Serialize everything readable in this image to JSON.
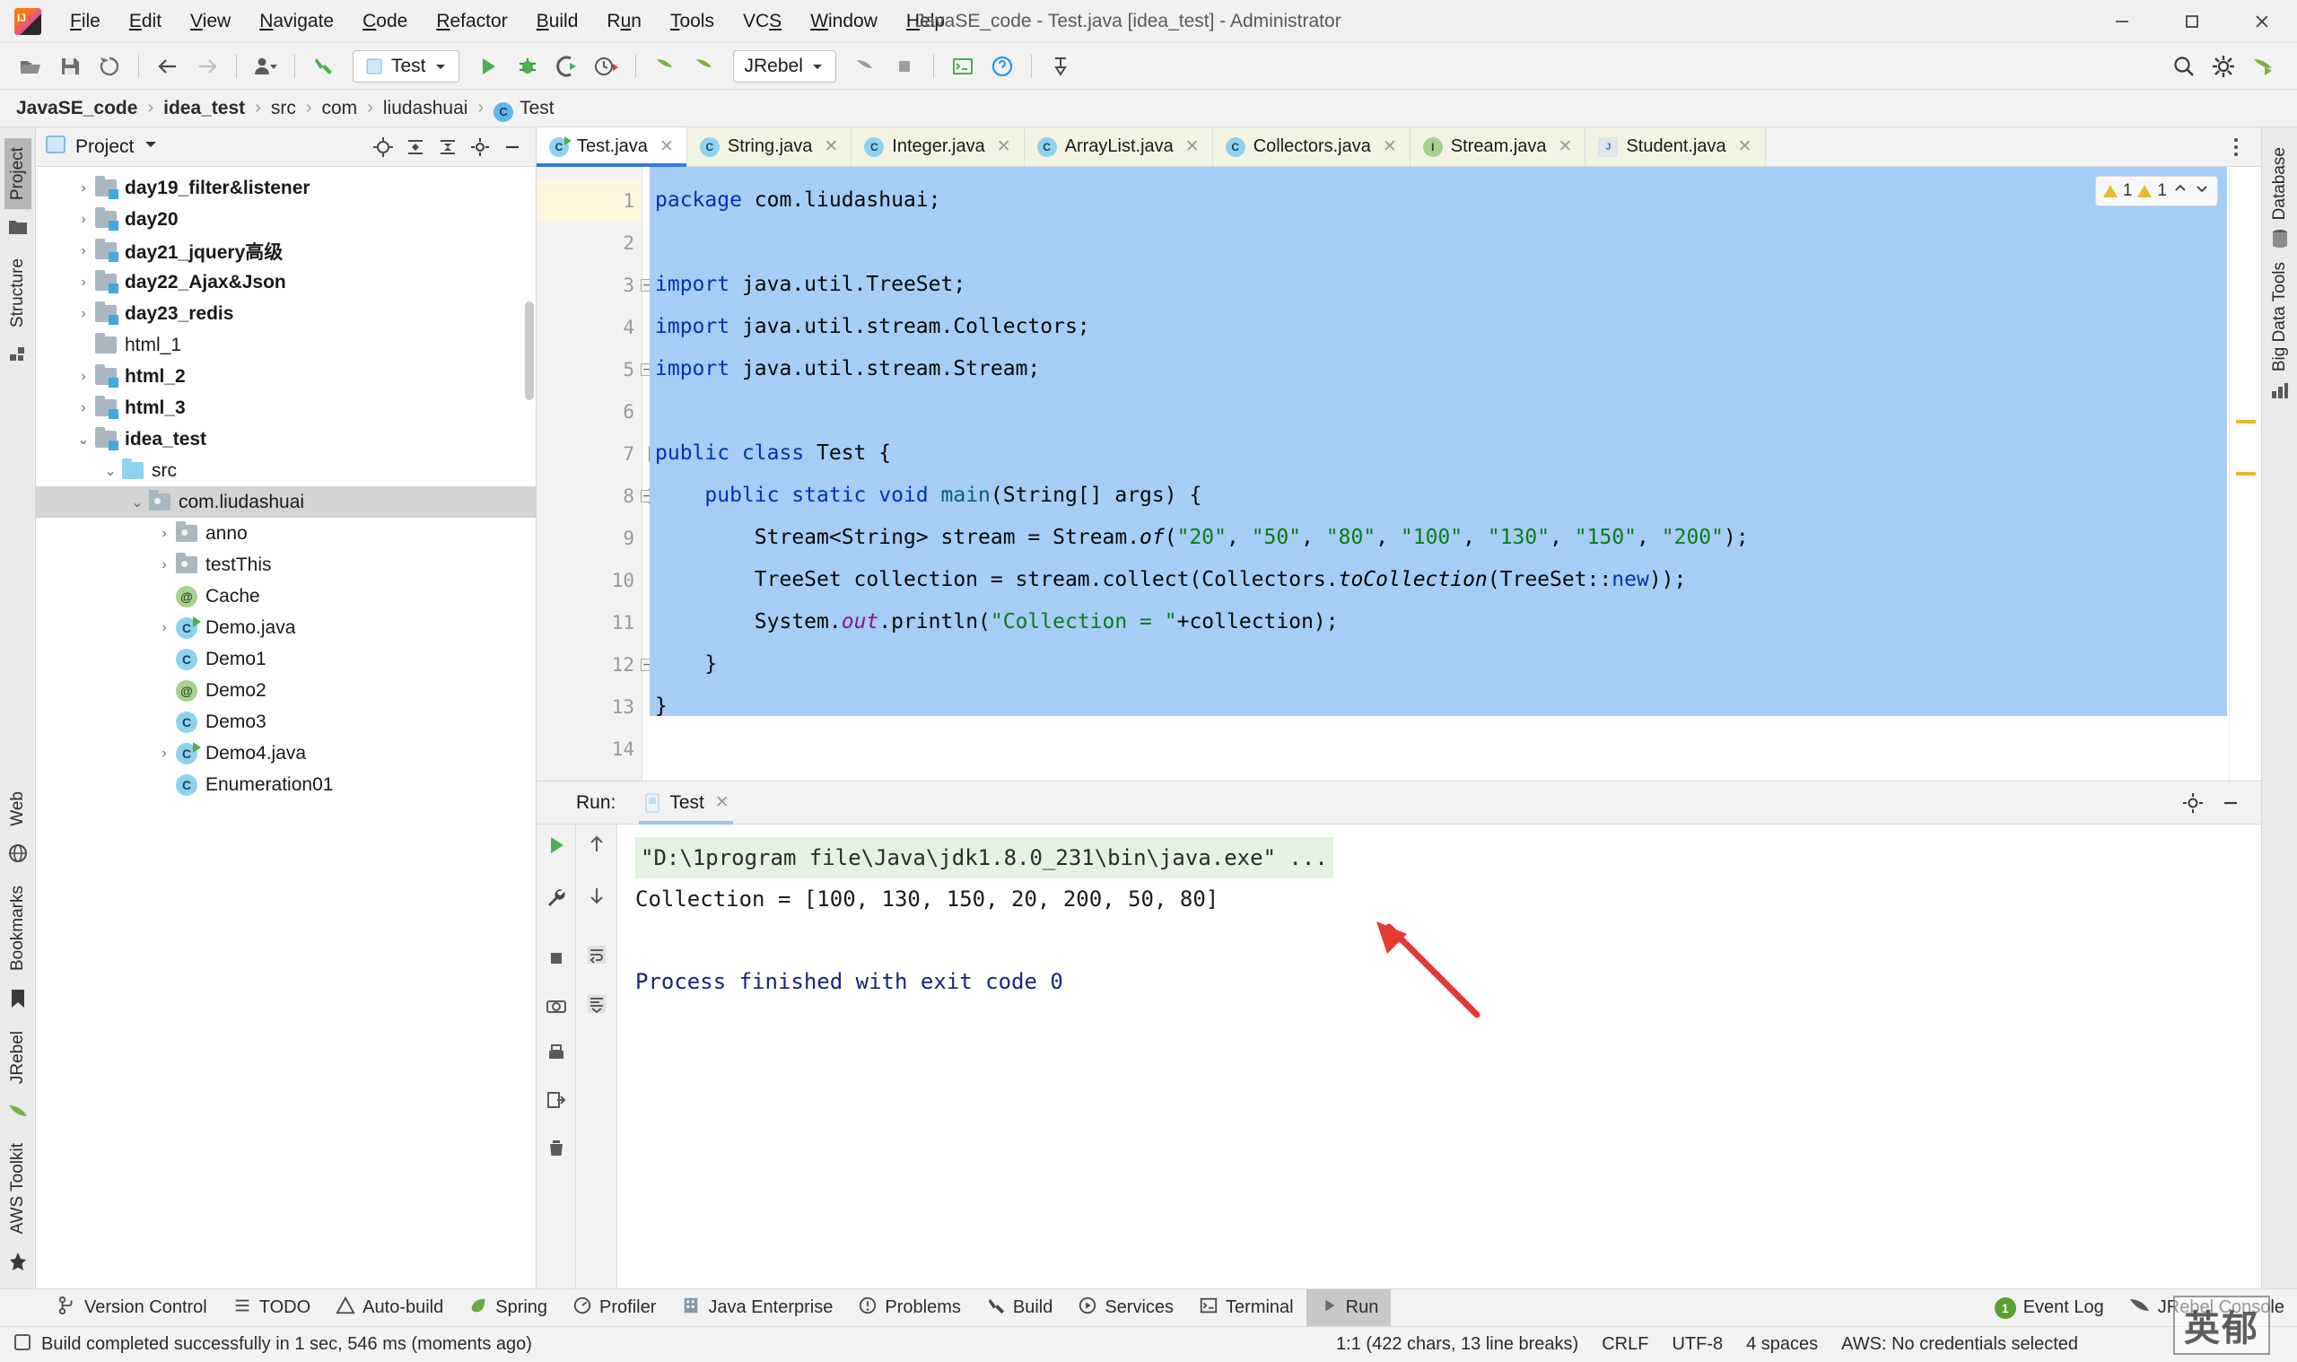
{
  "window": {
    "title": "JavaSE_code - Test.java [idea_test] - Administrator",
    "minimize": "—",
    "maximize": "❐",
    "close": "✕"
  },
  "menubar": [
    {
      "label": "File",
      "mnemonic": "F"
    },
    {
      "label": "Edit",
      "mnemonic": "E"
    },
    {
      "label": "View",
      "mnemonic": "V"
    },
    {
      "label": "Navigate",
      "mnemonic": "N"
    },
    {
      "label": "Code",
      "mnemonic": "C"
    },
    {
      "label": "Refactor",
      "mnemonic": "R"
    },
    {
      "label": "Build",
      "mnemonic": "B"
    },
    {
      "label": "Run",
      "mnemonic": "u"
    },
    {
      "label": "Tools",
      "mnemonic": "T"
    },
    {
      "label": "VCS",
      "mnemonic": "S"
    },
    {
      "label": "Window",
      "mnemonic": "W"
    },
    {
      "label": "Help",
      "mnemonic": "H"
    }
  ],
  "toolbar": {
    "run_config": "Test",
    "jrebel": "JRebel",
    "icons": [
      "open-folder-icon",
      "save-all-icon",
      "sync-icon",
      "back-icon",
      "forward-icon",
      "profile-icon",
      "build-hammer-icon",
      "run-icon",
      "debug-icon",
      "run-coverage-icon",
      "profiler-icon",
      "jrebel-run-icon",
      "jrebel-debug-icon",
      "update-icon",
      "stop-icon",
      "terminal-icon",
      "help-icon",
      "settings-icon",
      "translate-icon",
      "search-icon",
      "gear-icon",
      "jrebel-play-icon"
    ]
  },
  "breadcrumb": {
    "items": [
      "JavaSE_code",
      "idea_test",
      "src",
      "com",
      "liudashuai"
    ],
    "file": "Test"
  },
  "left_strip": {
    "tabs": [
      "Project",
      "Structure"
    ],
    "bottom_tabs": [
      "Web",
      "Bookmarks",
      "JRebel",
      "AWS Toolkit"
    ],
    "active": "Project"
  },
  "right_strip": {
    "tabs": [
      "Database",
      "Big Data Tools"
    ]
  },
  "project_panel": {
    "title": "Project",
    "tree": [
      {
        "label": "day19_filter&listener",
        "indent": 1,
        "arrow": "›",
        "icon": "folder-module",
        "bold": true,
        "selected": false
      },
      {
        "label": "day20",
        "indent": 1,
        "arrow": "›",
        "icon": "folder-module",
        "bold": true,
        "selected": false
      },
      {
        "label": "day21_jquery高级",
        "indent": 1,
        "arrow": "›",
        "icon": "folder-module",
        "bold": true,
        "selected": false
      },
      {
        "label": "day22_Ajax&Json",
        "indent": 1,
        "arrow": "›",
        "icon": "folder-module",
        "bold": true,
        "selected": false
      },
      {
        "label": "day23_redis",
        "indent": 1,
        "arrow": "›",
        "icon": "folder-module",
        "bold": true,
        "selected": false
      },
      {
        "label": "html_1",
        "indent": 1,
        "arrow": "",
        "icon": "folder-plain",
        "bold": false,
        "selected": false
      },
      {
        "label": "html_2",
        "indent": 1,
        "arrow": "›",
        "icon": "folder-module",
        "bold": true,
        "selected": false
      },
      {
        "label": "html_3",
        "indent": 1,
        "arrow": "›",
        "icon": "folder-module",
        "bold": true,
        "selected": false
      },
      {
        "label": "idea_test",
        "indent": 1,
        "arrow": "⌄",
        "icon": "folder-module",
        "bold": true,
        "selected": false
      },
      {
        "label": "src",
        "indent": 2,
        "arrow": "⌄",
        "icon": "folder-source",
        "bold": false,
        "selected": false
      },
      {
        "label": "com.liudashuai",
        "indent": 3,
        "arrow": "⌄",
        "icon": "folder-package",
        "bold": false,
        "selected": true
      },
      {
        "label": "anno",
        "indent": 4,
        "arrow": "›",
        "icon": "folder-package",
        "bold": false,
        "selected": false
      },
      {
        "label": "testThis",
        "indent": 4,
        "arrow": "›",
        "icon": "folder-package",
        "bold": false,
        "selected": false
      },
      {
        "label": "Cache",
        "indent": 4,
        "arrow": "",
        "icon": "annotation-class",
        "bold": false,
        "selected": false
      },
      {
        "label": "Demo.java",
        "indent": 4,
        "arrow": "›",
        "icon": "runnable-class",
        "bold": false,
        "selected": false
      },
      {
        "label": "Demo1",
        "indent": 4,
        "arrow": "",
        "icon": "java-class",
        "bold": false,
        "selected": false
      },
      {
        "label": "Demo2",
        "indent": 4,
        "arrow": "",
        "icon": "annotation-class",
        "bold": false,
        "selected": false
      },
      {
        "label": "Demo3",
        "indent": 4,
        "arrow": "",
        "icon": "java-class",
        "bold": false,
        "selected": false
      },
      {
        "label": "Demo4.java",
        "indent": 4,
        "arrow": "›",
        "icon": "runnable-class",
        "bold": false,
        "selected": false
      },
      {
        "label": "Enumeration01",
        "indent": 4,
        "arrow": "",
        "icon": "java-class",
        "bold": false,
        "selected": false
      }
    ]
  },
  "editor": {
    "tabs": [
      {
        "label": "Test.java",
        "icon": "runnable-class",
        "active": true
      },
      {
        "label": "String.java",
        "icon": "java-class",
        "active": false
      },
      {
        "label": "Integer.java",
        "icon": "java-class",
        "active": false
      },
      {
        "label": "ArrayList.java",
        "icon": "java-class",
        "active": false
      },
      {
        "label": "Collectors.java",
        "icon": "java-class",
        "active": false
      },
      {
        "label": "Stream.java",
        "icon": "interface",
        "active": false
      },
      {
        "label": "Student.java",
        "icon": "java-file",
        "active": false
      }
    ],
    "close_glyph": "✕",
    "inspection": {
      "warnings": "1",
      "weak_warnings": "1"
    },
    "line_numbers": [
      "1",
      "2",
      "3",
      "4",
      "5",
      "6",
      "7",
      "8",
      "9",
      "10",
      "11",
      "12",
      "13",
      "14"
    ],
    "lines": [
      {
        "n": 1,
        "tokens": [
          {
            "t": "package ",
            "c": "kw"
          },
          {
            "t": "com.liudashuai;",
            "c": "plain"
          }
        ]
      },
      {
        "n": 2,
        "tokens": []
      },
      {
        "n": 3,
        "tokens": [
          {
            "t": "import ",
            "c": "kw"
          },
          {
            "t": "java.util.TreeSet;",
            "c": "plain"
          }
        ]
      },
      {
        "n": 4,
        "tokens": [
          {
            "t": "import ",
            "c": "kw"
          },
          {
            "t": "java.util.stream.Collectors;",
            "c": "plain"
          }
        ]
      },
      {
        "n": 5,
        "tokens": [
          {
            "t": "import ",
            "c": "kw"
          },
          {
            "t": "java.util.stream.Stream;",
            "c": "plain"
          }
        ]
      },
      {
        "n": 6,
        "tokens": []
      },
      {
        "n": 7,
        "tokens": [
          {
            "t": "public class ",
            "c": "kw"
          },
          {
            "t": "Test {",
            "c": "plain"
          }
        ]
      },
      {
        "n": 8,
        "tokens": [
          {
            "t": "    ",
            "c": "plain"
          },
          {
            "t": "public static void ",
            "c": "kw"
          },
          {
            "t": "main",
            "c": "fn"
          },
          {
            "t": "(String[] args) {",
            "c": "plain"
          }
        ]
      },
      {
        "n": 9,
        "tokens": [
          {
            "t": "        Stream<String> stream = Stream.",
            "c": "plain"
          },
          {
            "t": "of",
            "c": "it"
          },
          {
            "t": "(",
            "c": "plain"
          },
          {
            "t": "\"20\"",
            "c": "str"
          },
          {
            "t": ", ",
            "c": "plain"
          },
          {
            "t": "\"50\"",
            "c": "str"
          },
          {
            "t": ", ",
            "c": "plain"
          },
          {
            "t": "\"80\"",
            "c": "str"
          },
          {
            "t": ", ",
            "c": "plain"
          },
          {
            "t": "\"100\"",
            "c": "str"
          },
          {
            "t": ", ",
            "c": "plain"
          },
          {
            "t": "\"130\"",
            "c": "str"
          },
          {
            "t": ", ",
            "c": "plain"
          },
          {
            "t": "\"150\"",
            "c": "str"
          },
          {
            "t": ", ",
            "c": "plain"
          },
          {
            "t": "\"200\"",
            "c": "str"
          },
          {
            "t": ");",
            "c": "plain"
          }
        ]
      },
      {
        "n": 10,
        "tokens": [
          {
            "t": "        TreeSet collection = stream.collect(Collectors.",
            "c": "plain"
          },
          {
            "t": "toCollection",
            "c": "it"
          },
          {
            "t": "(TreeSet::",
            "c": "plain"
          },
          {
            "t": "new",
            "c": "kw"
          },
          {
            "t": "));",
            "c": "plain"
          }
        ]
      },
      {
        "n": 11,
        "tokens": [
          {
            "t": "        System.",
            "c": "plain"
          },
          {
            "t": "out",
            "c": "stat"
          },
          {
            "t": ".println(",
            "c": "plain"
          },
          {
            "t": "\"Collection = \"",
            "c": "str"
          },
          {
            "t": "+collection);",
            "c": "plain"
          }
        ]
      },
      {
        "n": 12,
        "tokens": [
          {
            "t": "    }",
            "c": "plain"
          }
        ]
      },
      {
        "n": 13,
        "tokens": [
          {
            "t": "}",
            "c": "plain"
          }
        ]
      },
      {
        "n": 14,
        "tokens": []
      }
    ]
  },
  "run_panel": {
    "label": "Run:",
    "tab": "Test",
    "close_glyph": "✕",
    "console": [
      {
        "text": "\"D:\\1program file\\Java\\jdk1.8.0_231\\bin\\java.exe\" ...",
        "style": "cmd"
      },
      {
        "text": "Collection = [100, 130, 150, 20, 200, 50, 80]",
        "style": "out"
      },
      {
        "text": "",
        "style": "out"
      },
      {
        "text": "Process finished with exit code 0",
        "style": "fin"
      }
    ],
    "gutter_icons": [
      "rerun-icon",
      "wrench-icon",
      "stop-icon",
      "dump-icon",
      "camera-icon",
      "print-icon",
      "up-icon",
      "down-icon",
      "soft-wrap-icon",
      "scroll-to-end-icon",
      "clear-all-icon"
    ]
  },
  "toolwindow_bar": {
    "items": [
      {
        "label": "Version Control",
        "icon": "branch-icon",
        "active": false
      },
      {
        "label": "TODO",
        "icon": "list-icon",
        "active": false
      },
      {
        "label": "Auto-build",
        "icon": "warning-icon",
        "active": false
      },
      {
        "label": "Spring",
        "icon": "leaf-icon",
        "active": false
      },
      {
        "label": "Profiler",
        "icon": "gauge-icon",
        "active": false
      },
      {
        "label": "Java Enterprise",
        "icon": "enterprise-icon",
        "active": false
      },
      {
        "label": "Problems",
        "icon": "error-icon",
        "active": false
      },
      {
        "label": "Build",
        "icon": "hammer-icon",
        "active": false
      },
      {
        "label": "Services",
        "icon": "services-icon",
        "active": false
      },
      {
        "label": "Terminal",
        "icon": "terminal-icon",
        "active": false
      },
      {
        "label": "Run",
        "icon": "run-icon",
        "active": true
      }
    ]
  },
  "statusbar": {
    "message": "Build completed successfully in 1 sec, 546 ms (moments ago)",
    "caret": "1:1 (422 chars, 13 line breaks)",
    "line_separator": "CRLF",
    "encoding": "UTF-8",
    "indent": "4 spaces",
    "aws": "AWS: No credentials selected",
    "event_log": "Event Log",
    "event_log_count": "1",
    "jrebel_console": "JRebel Console",
    "watermark": "英郁"
  },
  "colors": {
    "accent": "#3879d9",
    "selection": "#a6cdf5",
    "keyword": "#0033b3",
    "string": "#067d17",
    "static_field": "#871094",
    "method": "#00627a",
    "run_green": "#4caf50",
    "arrow_red": "#e53935"
  }
}
